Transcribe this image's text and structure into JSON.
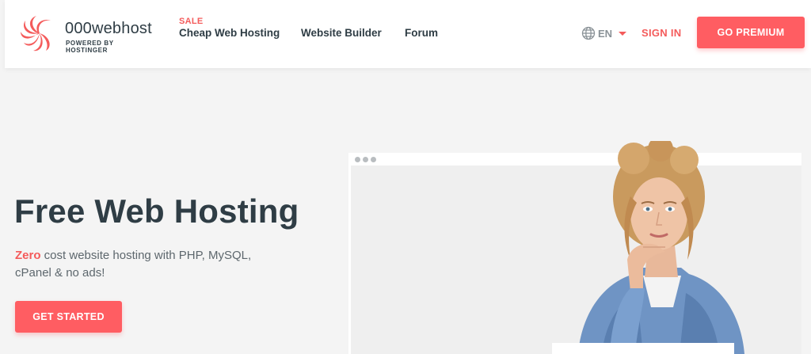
{
  "brand": {
    "name": "000webhost",
    "tagline": "POWERED BY HOSTINGER",
    "accent": "#ff5d62"
  },
  "nav": {
    "sale_badge": "SALE",
    "items": [
      {
        "label": "Cheap Web Hosting"
      },
      {
        "label": "Website Builder"
      },
      {
        "label": "Forum"
      }
    ],
    "language": {
      "icon": "globe-icon",
      "code": "EN"
    },
    "sign_in": "SIGN IN",
    "premium": "GO PREMIUM"
  },
  "hero": {
    "title": "Free Web Hosting",
    "subtitle_highlight": "Zero",
    "subtitle_rest": " cost website hosting with PHP, MySQL, cPanel & no ads!",
    "cta": "GET STARTED"
  },
  "colors": {
    "background": "#f4f4f4",
    "text_dark": "#2f3d45",
    "accent_red": "#ff5d62"
  }
}
